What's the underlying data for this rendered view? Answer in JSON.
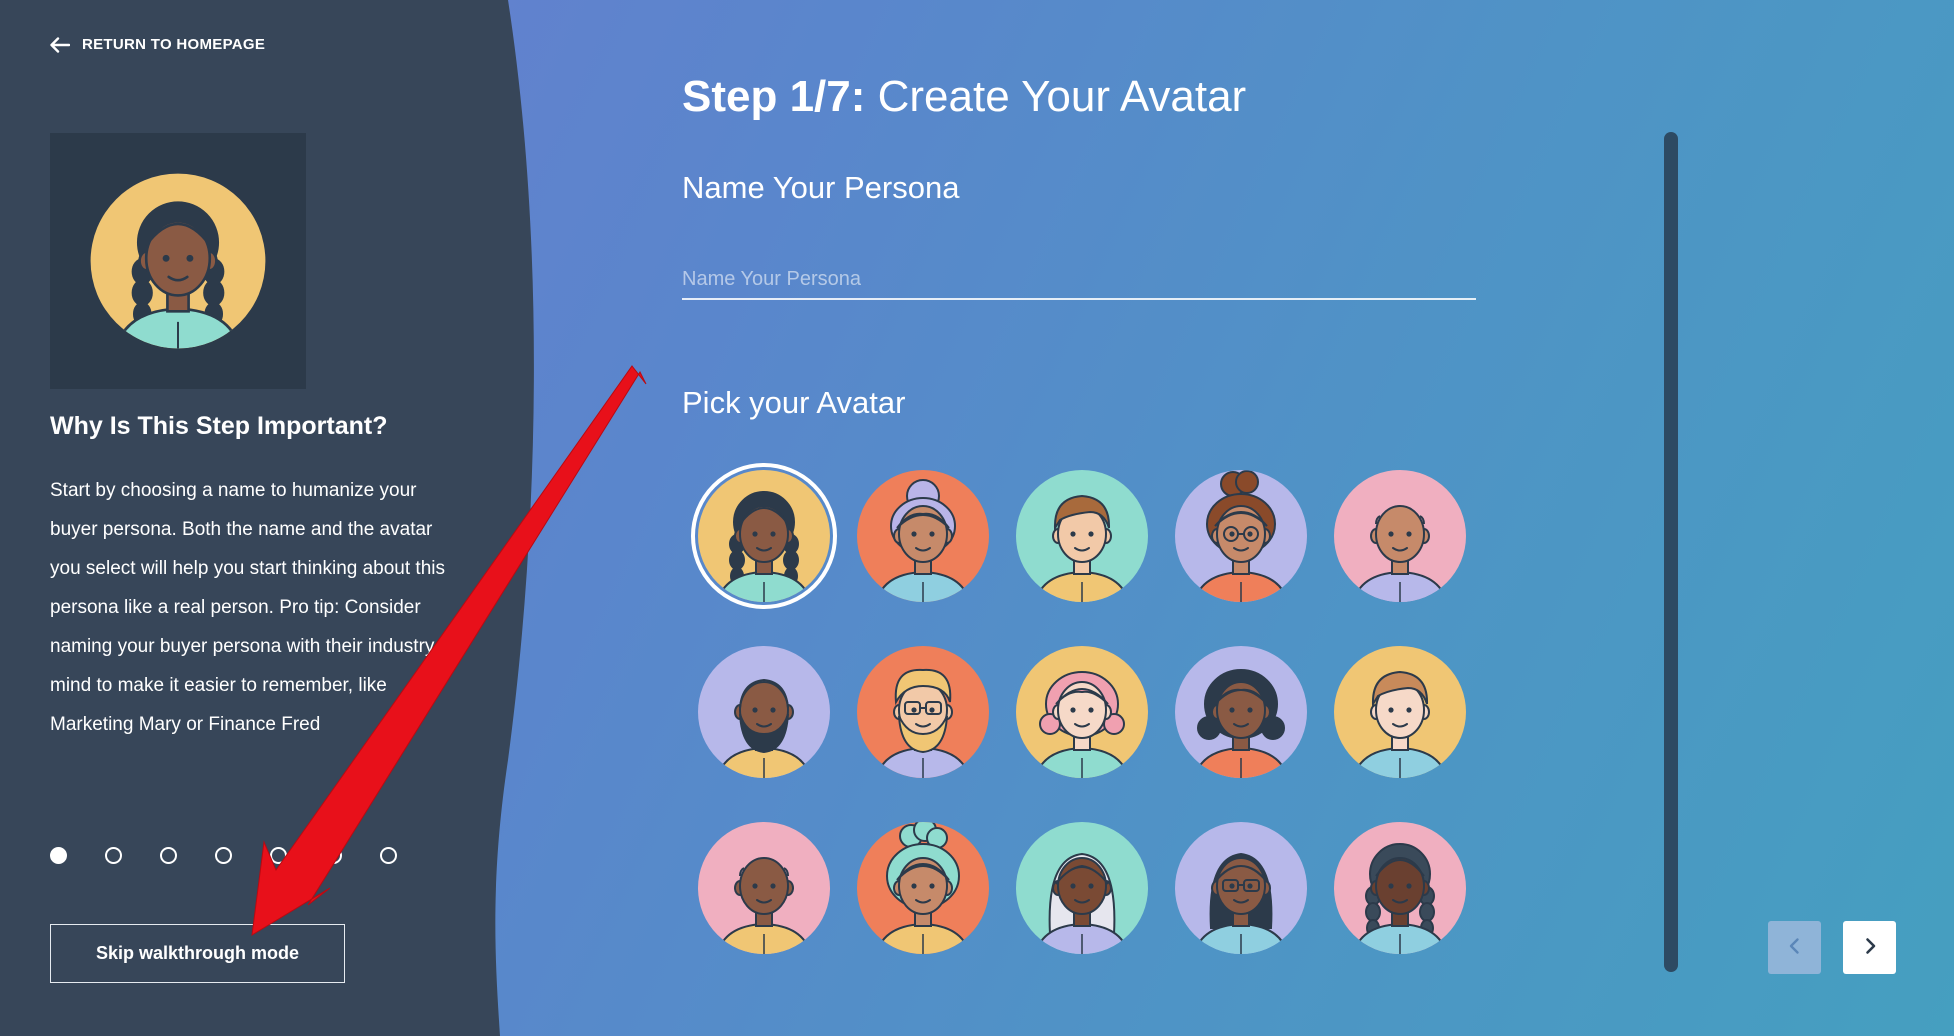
{
  "sidebar": {
    "return_label": "RETURN TO HOMEPAGE",
    "preview_avatar": "persona-avatar-1",
    "why_title": "Why Is This Step Important?",
    "why_text": "Start by choosing a name to humanize your buyer persona. Both the name and the avatar you select will help you start thinking about this persona like a real person. Pro tip: Consider naming your buyer persona with their industry in mind to make it easier to remember, like Marketing Mary or Finance Fred",
    "steps": {
      "total": 7,
      "current": 1
    },
    "skip_label": "Skip walkthrough mode"
  },
  "main": {
    "step_number": "Step 1/7:",
    "step_title": "Create Your Avatar",
    "name_heading": "Name Your Persona",
    "name_input": {
      "placeholder": "Name Your Persona",
      "value": ""
    },
    "pick_heading": "Pick your Avatar",
    "selected_avatar_index": 0,
    "avatars": [
      {
        "bg": "#f0c674",
        "skin": "#8a5a44",
        "hair": "#2c3a4a",
        "shirt": "#8fdccf",
        "style": "braids"
      },
      {
        "bg": "#ef7f5a",
        "skin": "#c68a6a",
        "hair": "#b9b4e8",
        "shirt": "#8fcfe0",
        "style": "bun-gray"
      },
      {
        "bg": "#8fdccf",
        "skin": "#f2c9a8",
        "hair": "#a86a3c",
        "shirt": "#f0c674",
        "style": "short"
      },
      {
        "bg": "#b7b8ea",
        "skin": "#c68a6a",
        "hair": "#8a4a2a",
        "shirt": "#ef7f5a",
        "style": "curly-bun-glasses"
      },
      {
        "bg": "#f0afc0",
        "skin": "#c68a6a",
        "hair": "#c68a6a",
        "shirt": "#b7b8ea",
        "style": "bald"
      },
      {
        "bg": "#b7b8ea",
        "skin": "#8a5a44",
        "hair": "#2c3a4a",
        "shirt": "#f0c674",
        "style": "beard"
      },
      {
        "bg": "#ef7f5a",
        "skin": "#f2c9a8",
        "hair": "#f0c674",
        "shirt": "#b7b8ea",
        "style": "beard-glasses"
      },
      {
        "bg": "#f0c674",
        "skin": "#f6d9c8",
        "hair": "#f0a0b0",
        "shirt": "#8fdccf",
        "style": "wavy"
      },
      {
        "bg": "#b7b8ea",
        "skin": "#8a5a44",
        "hair": "#2c3a4a",
        "shirt": "#ef7f5a",
        "style": "curly"
      },
      {
        "bg": "#f0c674",
        "skin": "#f6d9c8",
        "hair": "#c88a5a",
        "shirt": "#8fcfe0",
        "style": "short"
      },
      {
        "bg": "#f0afc0",
        "skin": "#8a5a44",
        "hair": "#8a5a44",
        "shirt": "#f0c674",
        "style": "bald"
      },
      {
        "bg": "#ef7f5a",
        "skin": "#c68a6a",
        "hair": "#8fdccf",
        "shirt": "#f0c674",
        "style": "curly-bun"
      },
      {
        "bg": "#8fdccf",
        "skin": "#7a4a34",
        "hair": "#e6e6ee",
        "shirt": "#b7b8ea",
        "style": "long-white"
      },
      {
        "bg": "#b7b8ea",
        "skin": "#8a5a44",
        "hair": "#2c3a4a",
        "shirt": "#8fcfe0",
        "style": "long-glasses"
      },
      {
        "bg": "#f0afc0",
        "skin": "#6a4030",
        "hair": "#3a4a5a",
        "shirt": "#8fcfe0",
        "style": "braids"
      }
    ]
  },
  "nav": {
    "prev_icon": "chevron-left-icon",
    "next_icon": "chevron-right-icon",
    "prev_disabled": true
  },
  "annotation": {
    "icon": "red-arrow-pointer",
    "color": "#e8101a"
  },
  "colors": {
    "sidebar": "#374659",
    "preview_bg": "#2c3a4a",
    "outline": "#2c3a4a"
  }
}
